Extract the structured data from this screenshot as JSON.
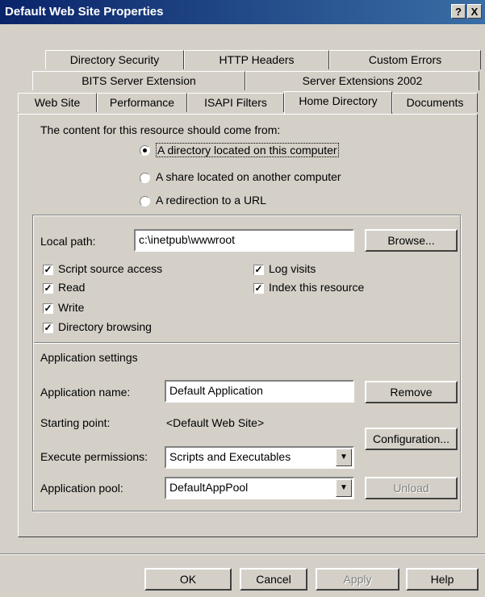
{
  "window": {
    "title": "Default Web Site Properties",
    "help_glyph": "?",
    "close_glyph": "X"
  },
  "tabs": {
    "row1": [
      "Directory Security",
      "HTTP Headers",
      "Custom Errors"
    ],
    "row2": [
      "BITS Server Extension",
      "Server Extensions 2002"
    ],
    "row3": [
      "Web Site",
      "Performance",
      "ISAPI Filters",
      "Home Directory",
      "Documents"
    ],
    "active": "Home Directory"
  },
  "content_source": {
    "heading": "The content for this resource should come from:",
    "options": [
      "A directory located on this computer",
      "A share located on another computer",
      "A redirection to a URL"
    ],
    "selected_index": 0
  },
  "local_path": {
    "label": "Local path:",
    "value": "c:\\inetpub\\wwwroot",
    "browse": "Browse..."
  },
  "checkboxes": {
    "script_source": {
      "label": "Script source access",
      "checked": true
    },
    "read": {
      "label": "Read",
      "checked": true
    },
    "write": {
      "label": "Write",
      "checked": true
    },
    "dir_browsing": {
      "label": "Directory browsing",
      "checked": true
    },
    "log_visits": {
      "label": "Log visits",
      "checked": true
    },
    "index_resource": {
      "label": "Index this resource",
      "checked": true
    }
  },
  "app_settings": {
    "heading": "Application settings",
    "name_label": "Application name:",
    "name_value": "Default Application",
    "remove": "Remove",
    "start_label": "Starting point:",
    "start_value": "<Default Web Site>",
    "configuration": "Configuration...",
    "exec_label": "Execute permissions:",
    "exec_value": "Scripts and Executables",
    "pool_label": "Application pool:",
    "pool_value": "DefaultAppPool",
    "unload": "Unload",
    "check_glyph": "✓",
    "dropdown_glyph": "▼"
  },
  "footer": {
    "ok": "OK",
    "cancel": "Cancel",
    "apply": "Apply",
    "help": "Help"
  }
}
